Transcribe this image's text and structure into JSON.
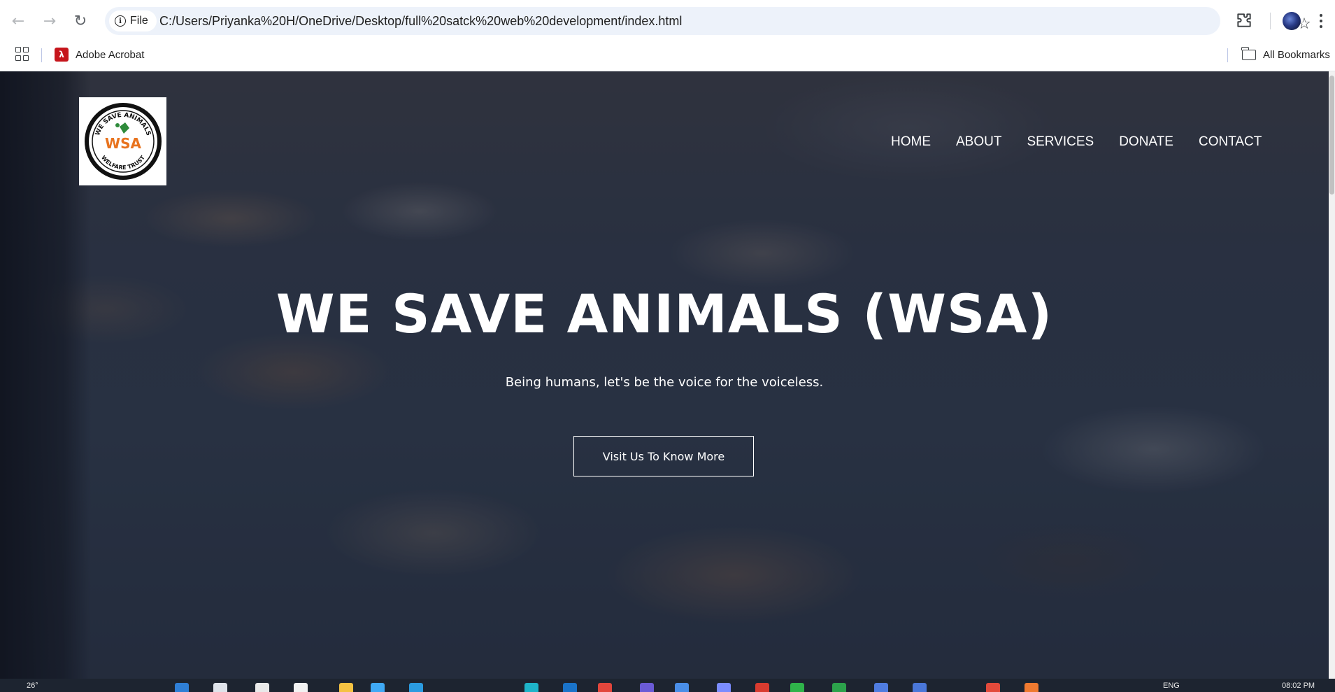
{
  "browser": {
    "back_icon": "arrow-left-icon",
    "forward_icon": "arrow-right-icon",
    "reload_icon": "reload-icon",
    "site_chip_label": "File",
    "url": "C:/Users/Priyanka%20H/OneDrive/Desktop/full%20satck%20web%20development/index.html",
    "bookmark_star_icon": "star-icon",
    "extensions_icon": "puzzle-icon",
    "menu_icon": "more-vert-icon"
  },
  "bookmarks_bar": {
    "items": [
      {
        "label": "Adobe Acrobat",
        "icon": "adobe-acrobat-icon"
      }
    ],
    "all_bookmarks_label": "All Bookmarks"
  },
  "site": {
    "logo_text": {
      "top": "WE SAVE ANIMALS",
      "center": "WSA",
      "bottom": "WELFARE TRUST"
    },
    "nav": [
      "HOME",
      "ABOUT",
      "SERVICES",
      "DONATE",
      "CONTACT"
    ],
    "hero": {
      "title": "WE SAVE ANIMALS (WSA)",
      "subtitle": "Being humans, let's be the voice for the voiceless.",
      "button_label": "Visit Us To Know More"
    }
  },
  "taskbar": {
    "weather_text": "26°",
    "language_text": "ENG",
    "clock_text": "08:02 PM"
  },
  "colors": {
    "omnibox_bg": "#edf2fa",
    "hero_overlay": "#0f1628",
    "acrobat_red": "#c6161c",
    "logo_orange": "#e8731e",
    "logo_green": "#2e8b3a"
  }
}
